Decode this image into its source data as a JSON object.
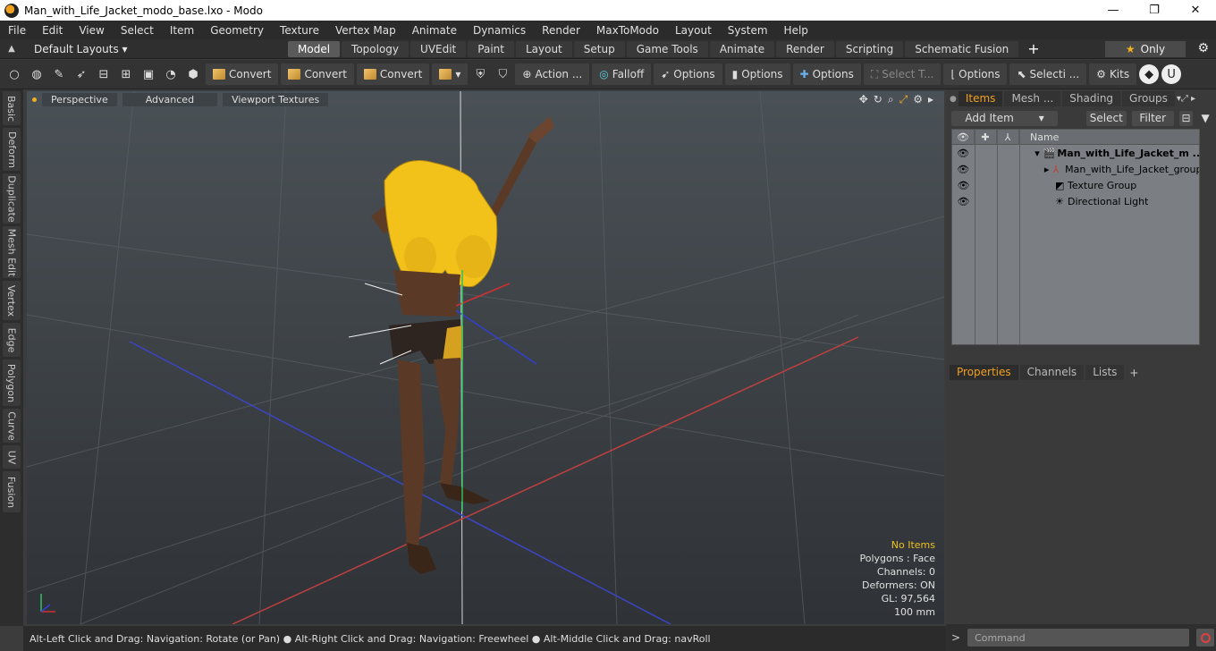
{
  "window": {
    "title": "Man_with_Life_Jacket_modo_base.lxo - Modo",
    "minimize": "—",
    "maximize": "❐",
    "close": "✕"
  },
  "menu": [
    "File",
    "Edit",
    "View",
    "Select",
    "Item",
    "Geometry",
    "Texture",
    "Vertex Map",
    "Animate",
    "Dynamics",
    "Render",
    "MaxToModo",
    "Layout",
    "System",
    "Help"
  ],
  "layouts": {
    "dropdown": "Default Layouts ▾",
    "tabs": [
      "Model",
      "Topology",
      "UVEdit",
      "Paint",
      "Layout",
      "Setup",
      "Game Tools",
      "Animate",
      "Render",
      "Scripting",
      "Schematic Fusion"
    ],
    "active_tab": "Model",
    "only_label": "Only"
  },
  "toolbar": {
    "convert1": "Convert",
    "convert2": "Convert",
    "convert3": "Convert",
    "action": "Action ...",
    "falloff": "Falloff",
    "options1": "Options",
    "options2": "Options",
    "options3": "Options",
    "select_t": "Select T...",
    "options4": "Options",
    "selecti": "Selecti ...",
    "kits": "Kits"
  },
  "left_tabs": [
    "Basic",
    "Deform",
    "Duplicate",
    "Mesh Edit",
    "Vertex",
    "Edge",
    "Polygon",
    "Curve",
    "UV",
    "Fusion"
  ],
  "viewport": {
    "tabs": [
      "Perspective",
      "Advanced",
      "Viewport Textures"
    ],
    "info": {
      "selection": "No Items",
      "polygons": "Polygons : Face",
      "channels": "Channels: 0",
      "deformers": "Deformers: ON",
      "gl": "GL: 97,564",
      "scale": "100 mm"
    }
  },
  "status": "Alt-Left Click and Drag: Navigation: Rotate (or Pan) ● Alt-Right Click and Drag: Navigation: Freewheel ● Alt-Middle Click and Drag: navRoll",
  "items_panel": {
    "tabs": [
      "Items",
      "Mesh ...",
      "Shading",
      "Groups"
    ],
    "active_tab": "Items",
    "add_item": "Add Item",
    "select": "Select",
    "filter": "Filter",
    "name_header": "Name",
    "rows": [
      {
        "name": "Man_with_Life_Jacket_m ...",
        "bold": true
      },
      {
        "name": "Man_with_Life_Jacket_group",
        "bold": false
      },
      {
        "name": "Texture Group",
        "bold": false
      },
      {
        "name": "Directional Light",
        "bold": false
      }
    ]
  },
  "props_panel": {
    "tabs": [
      "Properties",
      "Channels",
      "Lists"
    ],
    "active_tab": "Properties"
  },
  "command": {
    "placeholder": "Command"
  },
  "colors": {
    "accent": "#f0a020",
    "vest": "#f2c21a"
  }
}
